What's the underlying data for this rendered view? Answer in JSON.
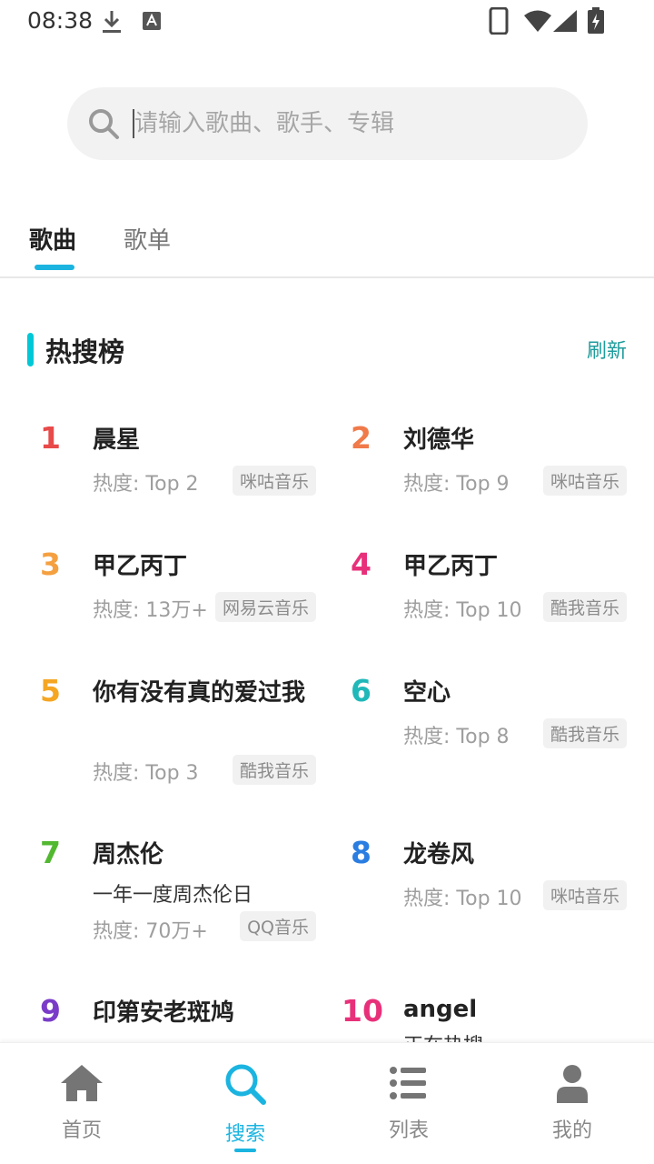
{
  "status_bar": {
    "time": "08:38"
  },
  "search": {
    "placeholder": "请输入歌曲、歌手、专辑"
  },
  "tabs": [
    {
      "label": "歌曲",
      "active": true
    },
    {
      "label": "歌单",
      "active": false
    }
  ],
  "hot_search": {
    "title": "热搜榜",
    "refresh_label": "刷新",
    "items": [
      {
        "rank": "1",
        "name": "晨星",
        "heat": "热度: Top 2",
        "source": "咪咕音乐",
        "color": "#e84a4a"
      },
      {
        "rank": "2",
        "name": "刘德华",
        "heat": "热度: Top 9",
        "source": "咪咕音乐",
        "color": "#f07a4a"
      },
      {
        "rank": "3",
        "name": "甲乙丙丁",
        "heat": "热度: 13万+",
        "source": "网易云音乐",
        "color": "#f5a040"
      },
      {
        "rank": "4",
        "name": "甲乙丙丁",
        "heat": "热度: Top 10",
        "source": "酷我音乐",
        "color": "#e8307a"
      },
      {
        "rank": "5",
        "name": "你有没有真的爱过我",
        "heat": "热度: Top 3",
        "source": "酷我音乐",
        "color": "#f5a623"
      },
      {
        "rank": "6",
        "name": "空心",
        "heat": "热度: Top 8",
        "source": "酷我音乐",
        "color": "#20b8b8"
      },
      {
        "rank": "7",
        "name": "周杰伦",
        "subtitle": "一年一度周杰伦日",
        "heat": "热度: 70万+",
        "source": "QQ音乐",
        "color": "#52b830"
      },
      {
        "rank": "8",
        "name": "龙卷风",
        "heat": "热度: Top 10",
        "source": "咪咕音乐",
        "color": "#2a7de1"
      },
      {
        "rank": "9",
        "name": "印第安老斑鸠",
        "color": "#7a3cc8"
      },
      {
        "rank": "10",
        "name": "angel",
        "subtitle": "正在热搜",
        "color": "#e8307a"
      }
    ]
  },
  "bottom_nav": [
    {
      "label": "首页",
      "icon": "home-icon",
      "active": false
    },
    {
      "label": "搜索",
      "icon": "search-icon",
      "active": true
    },
    {
      "label": "列表",
      "icon": "list-icon",
      "active": false
    },
    {
      "label": "我的",
      "icon": "profile-icon",
      "active": false
    }
  ]
}
